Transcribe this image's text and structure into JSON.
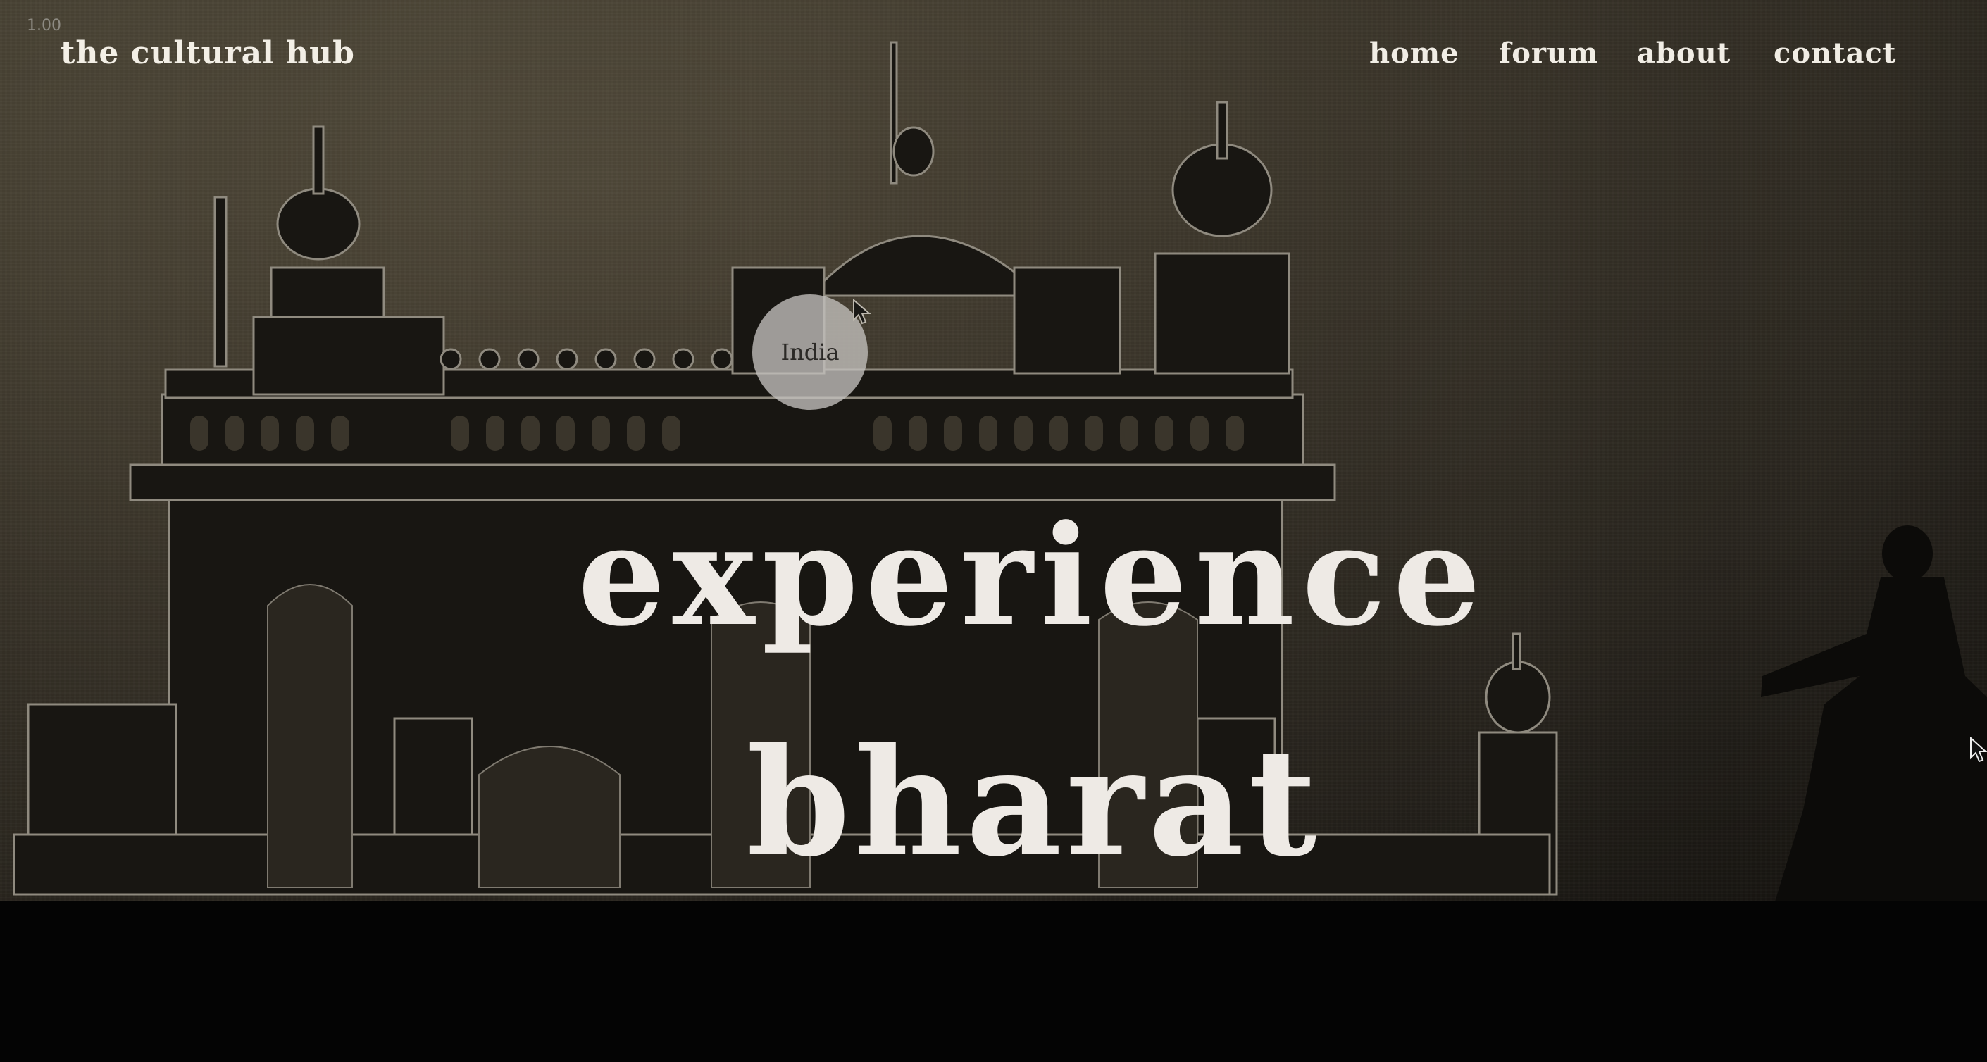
{
  "overlay": {
    "zoom_label": "1.00"
  },
  "brand": {
    "name": "the cultural hub"
  },
  "nav": {
    "items": [
      {
        "label": "home"
      },
      {
        "label": "forum"
      },
      {
        "label": "about"
      },
      {
        "label": "contact"
      }
    ]
  },
  "hero": {
    "bubble_label": "India",
    "headline_line1": "experience",
    "headline_line2": "bharat",
    "background_image": "golden-temple-silhouette",
    "figure_image": "dancer-silhouette"
  },
  "colors": {
    "background": "#4b4436",
    "text": "#eeeae5",
    "bottom_band": "#040404",
    "bubble": "#c4c2be"
  }
}
